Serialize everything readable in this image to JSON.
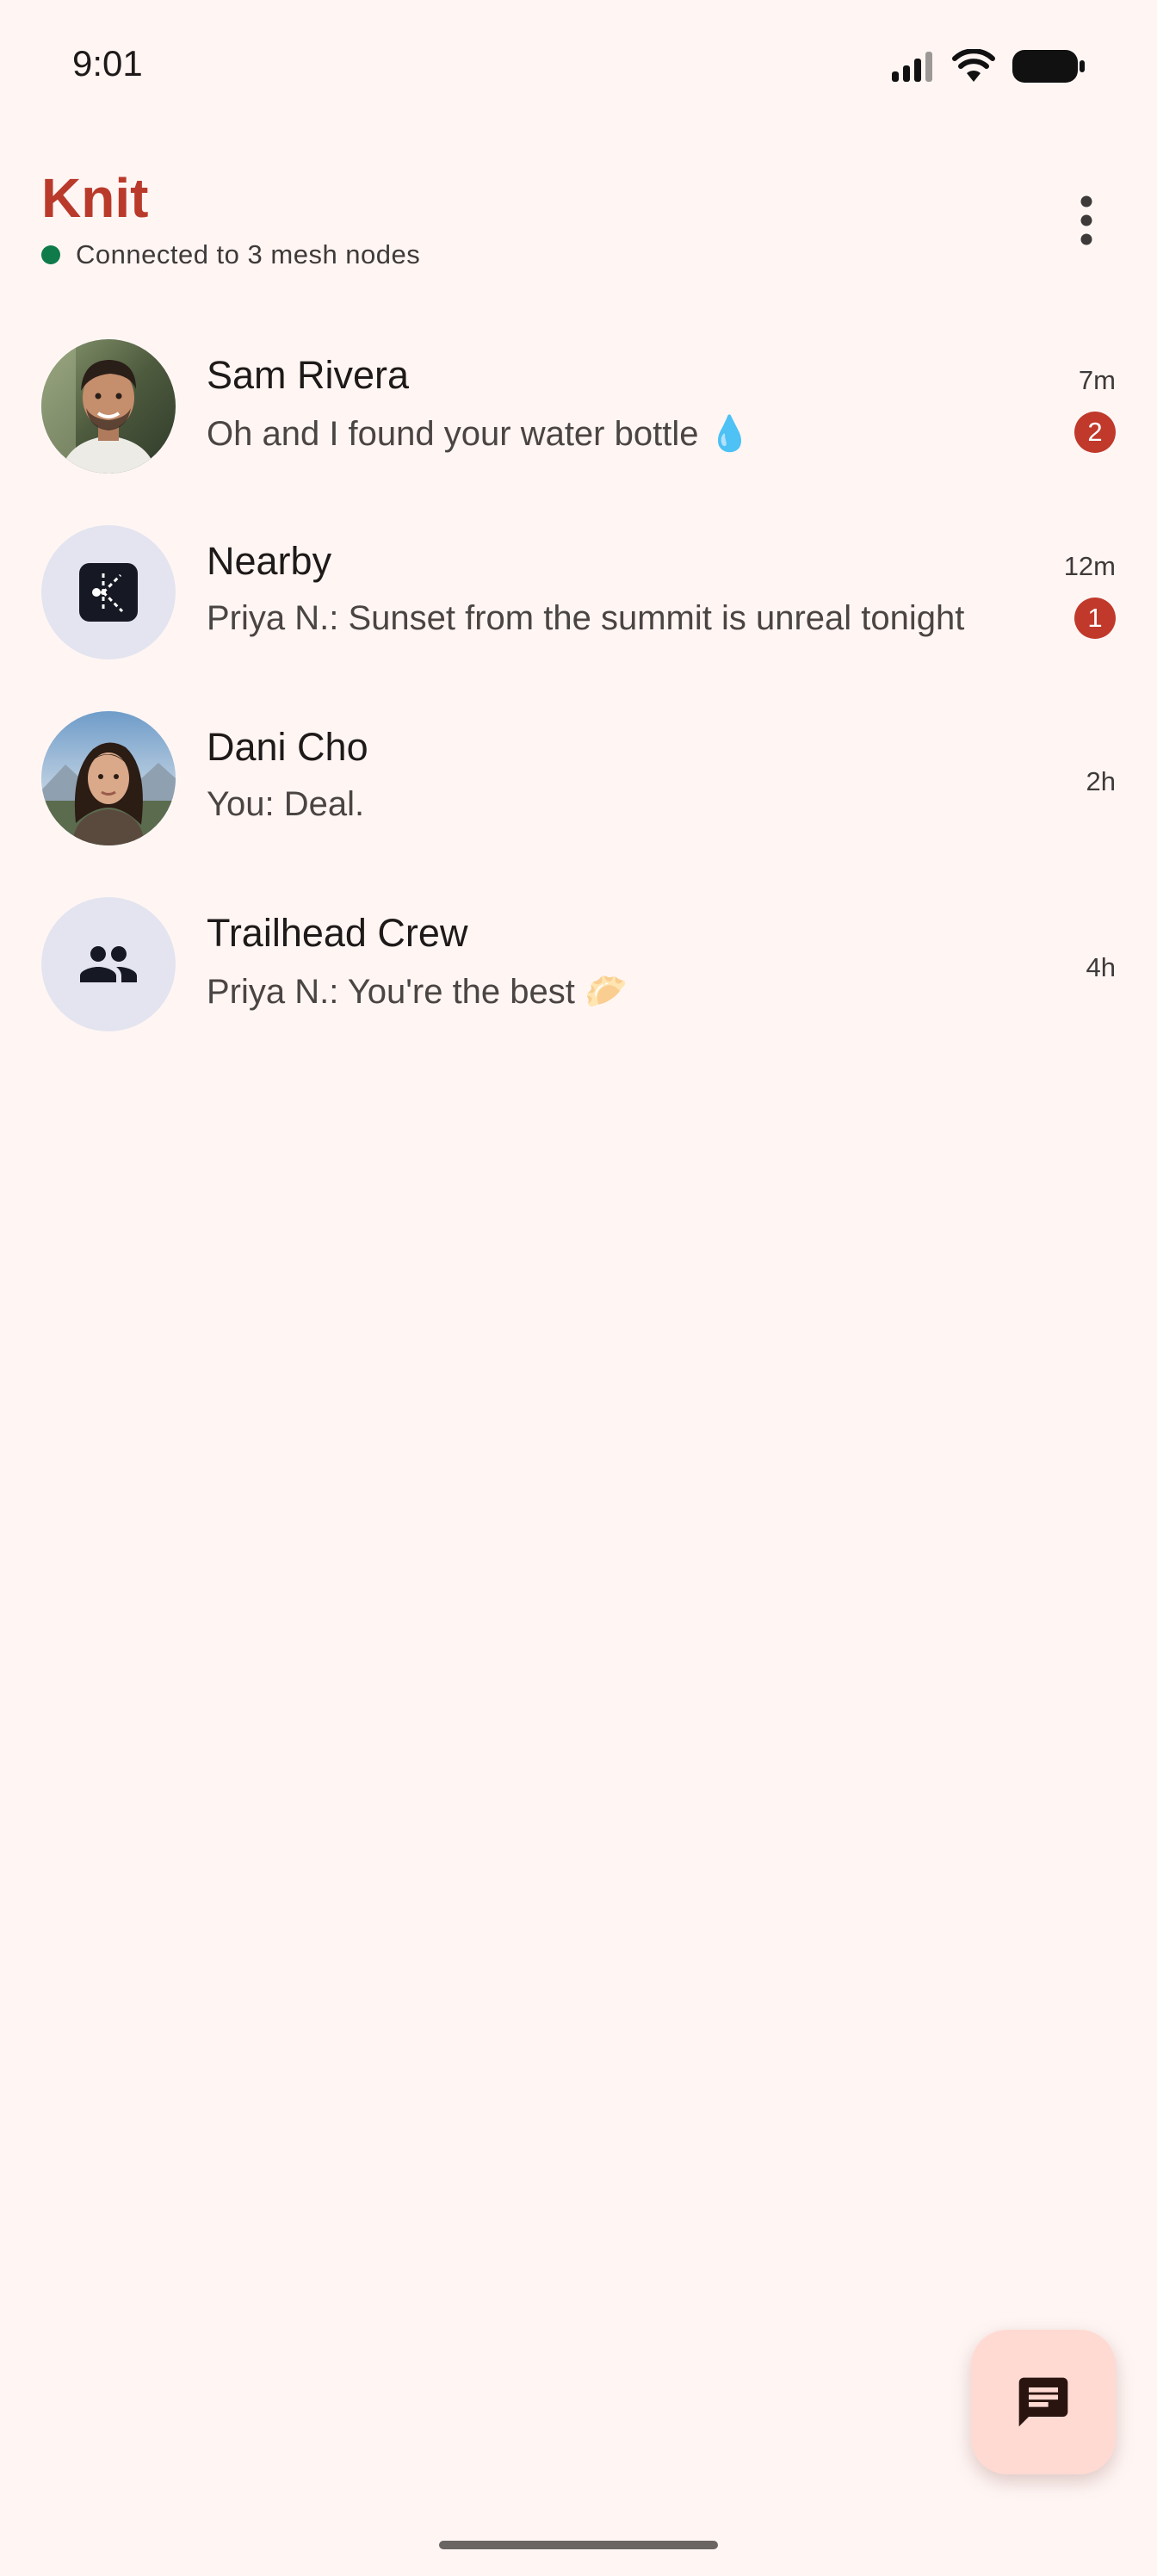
{
  "status_bar": {
    "time": "9:01"
  },
  "header": {
    "title": "Knit",
    "connection_status": "Connected to 3 mesh nodes",
    "menu_icon": "more-vert-icon",
    "colors": {
      "title": "#B93A2B",
      "connected_dot": "#0F7A4A"
    }
  },
  "chats": [
    {
      "name": "Sam Rivera",
      "preview": "Oh and I found your water bottle 💧",
      "time": "7m",
      "unread": "2",
      "avatar": "photo"
    },
    {
      "name": "Nearby",
      "preview": "Priya N.: Sunset from the summit is unreal tonight",
      "time": "12m",
      "unread": "1",
      "avatar": "knit-mesh-icon"
    },
    {
      "name": "Dani Cho",
      "preview": "You: Deal.",
      "time": "2h",
      "avatar": "photo"
    },
    {
      "name": "Trailhead Crew",
      "preview": "Priya N.: You're the best 🥟",
      "time": "4h",
      "avatar": "group-icon"
    }
  ],
  "fab": {
    "icon": "chat-icon",
    "color": "#FFDAD3"
  }
}
